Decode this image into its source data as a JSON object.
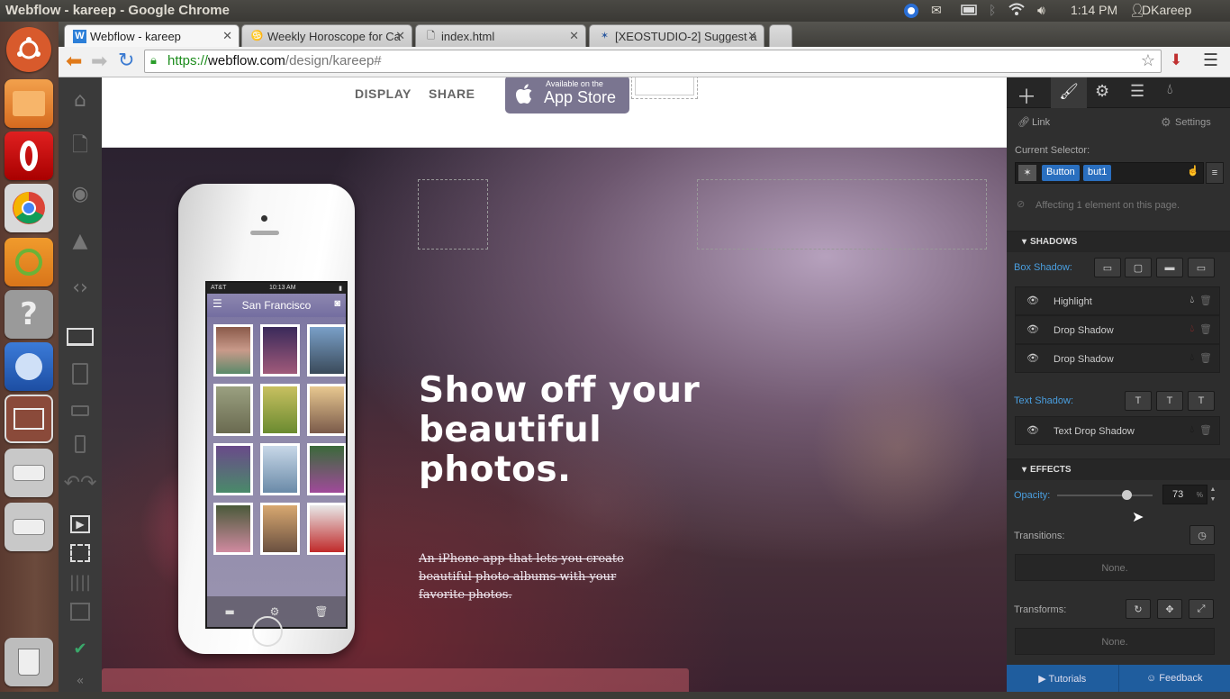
{
  "os": {
    "window_title": "Webflow - kareep - Google Chrome",
    "clock": "1:14 PM",
    "user": "DKareep"
  },
  "browser": {
    "tabs": [
      {
        "label": "Webflow - kareep",
        "icon": "webflow-icon"
      },
      {
        "label": "Weekly Horoscope for Ca",
        "icon": "horoscope-icon"
      },
      {
        "label": "index.html",
        "icon": "file-icon"
      },
      {
        "label": "[XEOSTUDIO-2] Suggest a",
        "icon": "jira-icon"
      }
    ],
    "url_scheme": "https://",
    "url_host": "webflow.com",
    "url_path": "/design/kareep#"
  },
  "canvas": {
    "nav": {
      "display": "DISPLAY",
      "share": "SHARE",
      "appstore_top": "Available on the",
      "appstore_main": "App Store"
    },
    "phone": {
      "status": "10:13 AM",
      "carrier": "AT&T",
      "title": "San Francisco"
    },
    "hero": {
      "heading_line1": "Show off your",
      "heading_line2": "beautiful",
      "heading_line3": "photos.",
      "subtext": "An iPhone app that lets you create beautiful photo albums with your favorite photos."
    }
  },
  "panel": {
    "link_label": "Link",
    "settings_label": "Settings",
    "current_selector_label": "Current Selector:",
    "selector_tags": [
      "Button",
      "but1"
    ],
    "affecting": "Affecting 1 element on this page.",
    "shadows_header": "SHADOWS",
    "box_shadow_label": "Box Shadow:",
    "box_shadows": [
      "Highlight",
      "Drop Shadow",
      "Drop Shadow"
    ],
    "text_shadow_label": "Text Shadow:",
    "text_shadows": [
      "Text Drop Shadow"
    ],
    "effects_header": "EFFECTS",
    "opacity_label": "Opacity:",
    "opacity_value": "73",
    "opacity_unit": "%",
    "opacity_fraction": 0.73,
    "transitions_label": "Transitions:",
    "transitions_value": "None.",
    "transforms_label": "Transforms:",
    "transforms_value": "None.",
    "tutorials": "Tutorials",
    "feedback": "Feedback"
  }
}
